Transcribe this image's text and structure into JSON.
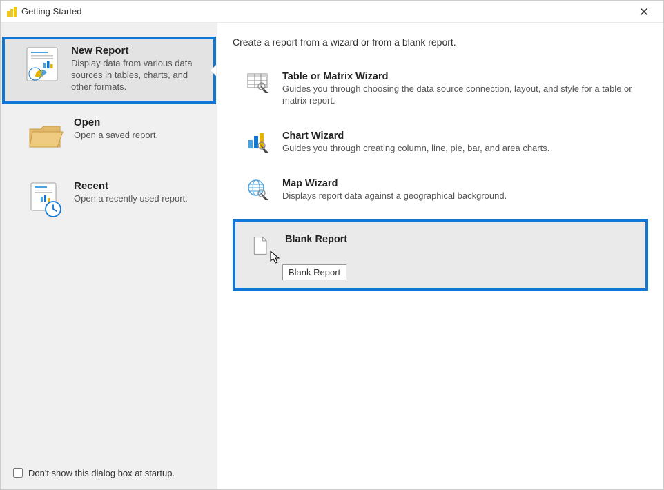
{
  "window": {
    "title": "Getting Started"
  },
  "sidebar": {
    "items": [
      {
        "title": "New Report",
        "desc": "Display data from various data sources in tables, charts, and other formats."
      },
      {
        "title": "Open",
        "desc": "Open a saved report."
      },
      {
        "title": "Recent",
        "desc": "Open a recently used report."
      }
    ]
  },
  "footer": {
    "checkbox_label": "Don't show this dialog box at startup."
  },
  "main": {
    "heading": "Create a report from a wizard or from a blank report.",
    "options": [
      {
        "title": "Table or Matrix Wizard",
        "desc": "Guides you through choosing the data source connection, layout, and style for a table or matrix report."
      },
      {
        "title": "Chart Wizard",
        "desc": "Guides you through creating column, line, pie, bar, and area charts."
      },
      {
        "title": "Map Wizard",
        "desc": "Displays report data against a geographical background."
      },
      {
        "title": "Blank Report",
        "desc": "",
        "tooltip": "Blank Report"
      }
    ]
  }
}
